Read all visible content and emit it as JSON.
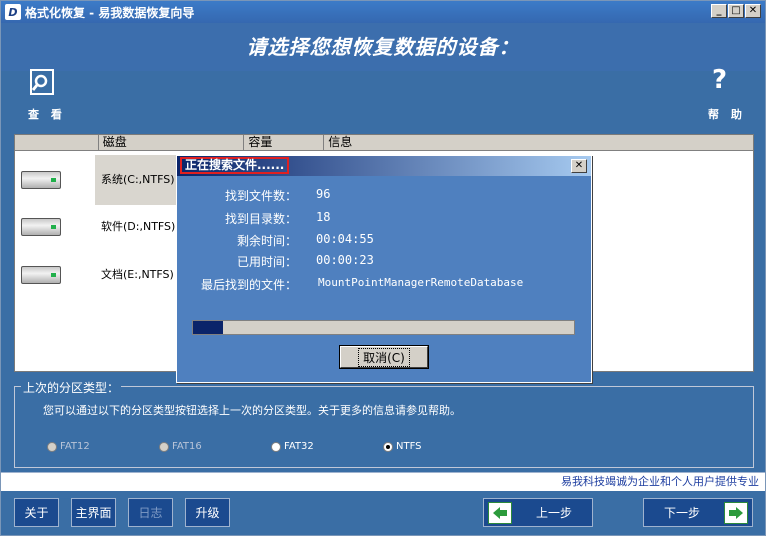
{
  "window": {
    "title": "格式化恢复 - 易我数据恢复向导",
    "app_icon": "D"
  },
  "header": {
    "title": "请选择您想恢复数据的设备："
  },
  "toolbar": {
    "view_label": "查 看",
    "help_label": "帮 助"
  },
  "list": {
    "columns": [
      "磁盘",
      "容量",
      "信息"
    ],
    "rows": [
      {
        "name": "系统(C:,NTFS)",
        "selected": true
      },
      {
        "name": "软件(D:,NTFS)",
        "selected": false
      },
      {
        "name": "文档(E:,NTFS)",
        "selected": false
      }
    ]
  },
  "partition": {
    "legend": "上次的分区类型：",
    "description": "您可以通过以下的分区类型按钮选择上一次的分区类型。关于更多的信息请参见帮助。",
    "options": [
      {
        "label": "FAT12",
        "checked": false,
        "enabled": false
      },
      {
        "label": "FAT16",
        "checked": false,
        "enabled": false
      },
      {
        "label": "FAT32",
        "checked": false,
        "enabled": true
      },
      {
        "label": "NTFS",
        "checked": true,
        "enabled": true
      }
    ]
  },
  "status_text": "易我科技竭诚为企业和个人用户提供专业",
  "buttons": {
    "about": "关于",
    "home": "主界面",
    "log": "日志",
    "upgrade": "升级",
    "prev": "上一步",
    "next": "下一步"
  },
  "dialog": {
    "title": "正在搜索文件......",
    "files_found_label": "找到文件数：",
    "files_found": "96",
    "dirs_found_label": "找到目录数：",
    "dirs_found": "18",
    "remaining_label": "剩余时间：",
    "remaining": "00:04:55",
    "elapsed_label": "已用时间：",
    "elapsed": "00:00:23",
    "last_file_label": "最后找到的文件：",
    "last_file": "MountPointManagerRemoteDatabase",
    "progress_percent": 8,
    "cancel_label": "取消(C)"
  },
  "colors": {
    "background": "#3a6ea5",
    "dialog": "#4f80bf",
    "button": "#1b4a8f",
    "progress_fill": "#0a246a"
  }
}
